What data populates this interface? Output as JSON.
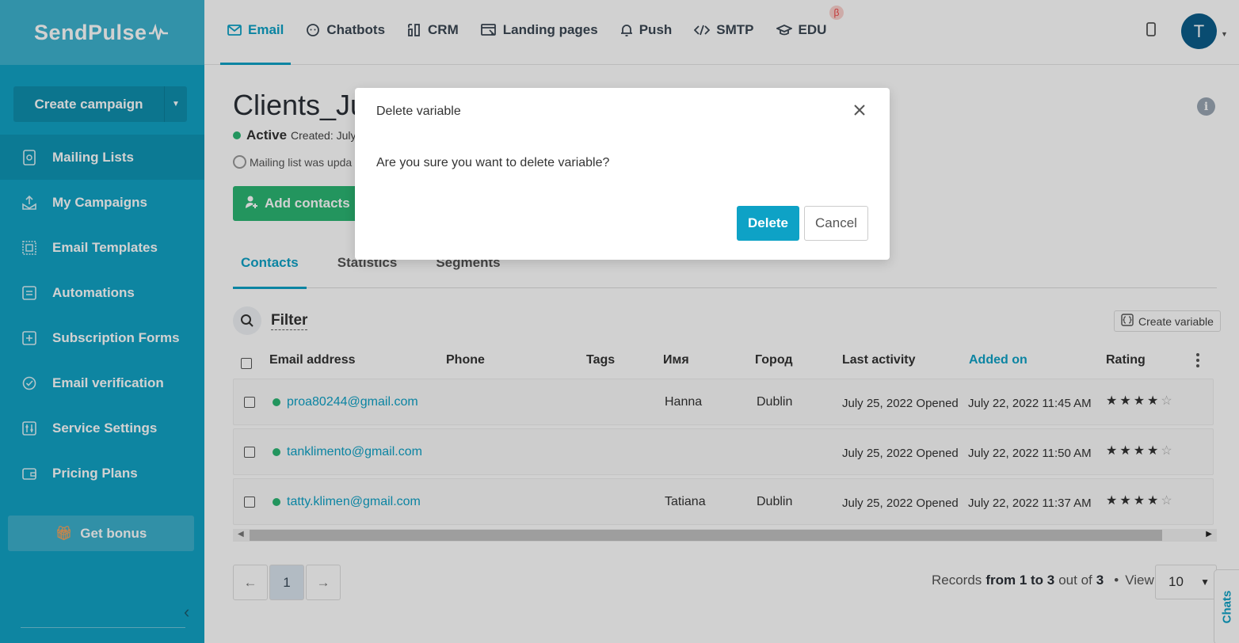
{
  "brand": {
    "name": "SendPulse"
  },
  "sidebar": {
    "create_campaign_label": "Create campaign",
    "items": [
      {
        "label": "Mailing Lists",
        "icon": "mailing-list-icon"
      },
      {
        "label": "My Campaigns",
        "icon": "campaigns-icon"
      },
      {
        "label": "Email Templates",
        "icon": "templates-icon"
      },
      {
        "label": "Automations",
        "icon": "automations-icon"
      },
      {
        "label": "Subscription Forms",
        "icon": "forms-icon"
      },
      {
        "label": "Email verification",
        "icon": "verification-icon"
      },
      {
        "label": "Service Settings",
        "icon": "settings-icon"
      },
      {
        "label": "Pricing Plans",
        "icon": "wallet-icon"
      }
    ],
    "bonus_label": "Get bonus"
  },
  "topnav": {
    "tabs": [
      {
        "label": "Email"
      },
      {
        "label": "Chatbots"
      },
      {
        "label": "CRM"
      },
      {
        "label": "Landing pages"
      },
      {
        "label": "Push"
      },
      {
        "label": "SMTP"
      },
      {
        "label": "EDU"
      }
    ],
    "beta": "β",
    "avatar_initial": "T"
  },
  "page": {
    "title": "Clients_Ju",
    "status": "Active",
    "created_text": "Created: July",
    "update_note": "Mailing list was upda",
    "add_contacts_label": "Add contacts",
    "tabs": [
      "Contacts",
      "Statistics",
      "Segments"
    ],
    "filter_label": "Filter",
    "create_variable_label": "Create variable"
  },
  "table": {
    "columns": [
      "Email address",
      "Phone",
      "Tags",
      "Имя",
      "Город",
      "Last activity",
      "Added on",
      "Rating"
    ],
    "rows": [
      {
        "email": "proa80244@gmail.com",
        "phone": "",
        "tags": "",
        "name": "Hanna",
        "city": "Dublin",
        "last_activity": "July 25, 2022 Opened",
        "added_on": "July 22, 2022 11:45 AM",
        "rating": 4
      },
      {
        "email": "tanklimento@gmail.com",
        "phone": "",
        "tags": "",
        "name": "",
        "city": "",
        "last_activity": "July 25, 2022 Opened",
        "added_on": "July 22, 2022 11:50 AM",
        "rating": 4
      },
      {
        "email": "tatty.klimen@gmail.com",
        "phone": "",
        "tags": "",
        "name": "Tatiana",
        "city": "Dublin",
        "last_activity": "July 25, 2022 Opened",
        "added_on": "July 22, 2022 11:37 AM",
        "rating": 4
      }
    ]
  },
  "pagination": {
    "prev": "←",
    "current": "1",
    "next": "→",
    "records_prefix": "Records",
    "records_range": "from 1 to 3",
    "records_outof": "out of",
    "records_total": "3",
    "view_label": "View",
    "view_value": "10"
  },
  "chats_label": "Chats",
  "modal": {
    "title": "Delete variable",
    "message": "Are you sure you want to delete variable?",
    "delete_label": "Delete",
    "cancel_label": "Cancel"
  }
}
